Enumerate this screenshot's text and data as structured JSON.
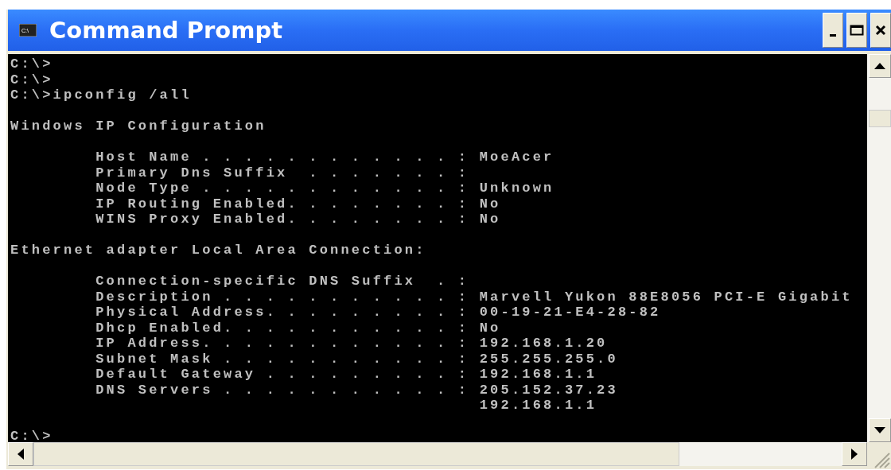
{
  "window": {
    "title": "Command Prompt",
    "icon_label": "C:\\"
  },
  "console": {
    "blocks": [
      {
        "lines": [
          "C:\\>",
          "C:\\>",
          "C:\\>ipconfig /all"
        ]
      },
      {
        "lines": [
          "Windows IP Configuration"
        ]
      },
      {
        "lines": [
          "        Host Name . . . . . . . . . . . . : MoeAcer",
          "        Primary Dns Suffix  . . . . . . . :",
          "        Node Type . . . . . . . . . . . . : Unknown",
          "        IP Routing Enabled. . . . . . . . : No",
          "        WINS Proxy Enabled. . . . . . . . : No"
        ]
      },
      {
        "lines": [
          "Ethernet adapter Local Area Connection:"
        ]
      },
      {
        "lines": [
          "        Connection-specific DNS Suffix  . :",
          "        Description . . . . . . . . . . . : Marvell Yukon 88E8056 PCI-E Gigabit",
          "        Physical Address. . . . . . . . . : 00-19-21-E4-28-82",
          "        Dhcp Enabled. . . . . . . . . . . : No",
          "        IP Address. . . . . . . . . . . . : 192.168.1.20",
          "        Subnet Mask . . . . . . . . . . . : 255.255.255.0",
          "        Default Gateway . . . . . . . . . : 192.168.1.1",
          "        DNS Servers . . . . . . . . . . . : 205.152.37.23",
          "                                            192.168.1.1"
        ]
      },
      {
        "lines": [
          "C:\\>"
        ]
      }
    ]
  }
}
